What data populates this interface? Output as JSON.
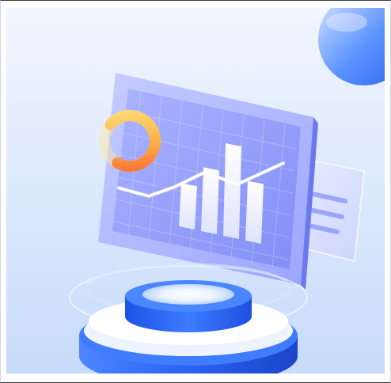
{
  "image": {
    "subject": "3d-analytics-dashboard-illustration",
    "palette": {
      "background_top": "#eef4ff",
      "background_bottom": "#c9dcfb",
      "card_front": "#8f98ff",
      "card_back": "#aeb6ff",
      "card_edge": "#6f7cf2",
      "bars": "#ffffff",
      "donut_orange": "#ff7a3d",
      "donut_yellow": "#ffd66b",
      "podium_top": "#2b6cff",
      "podium_side": "#1f4fe0",
      "podium_ring": "#ffffff",
      "glow": "#f2f8ff",
      "corner_sphere": "#4b86ff"
    },
    "chart_marks": {
      "bar_levels": [
        0.42,
        0.62,
        0.9,
        0.58
      ],
      "line_levels": [
        0.25,
        0.18,
        0.36,
        0.6,
        0.48,
        0.82
      ],
      "donut_fraction": 0.72
    }
  }
}
